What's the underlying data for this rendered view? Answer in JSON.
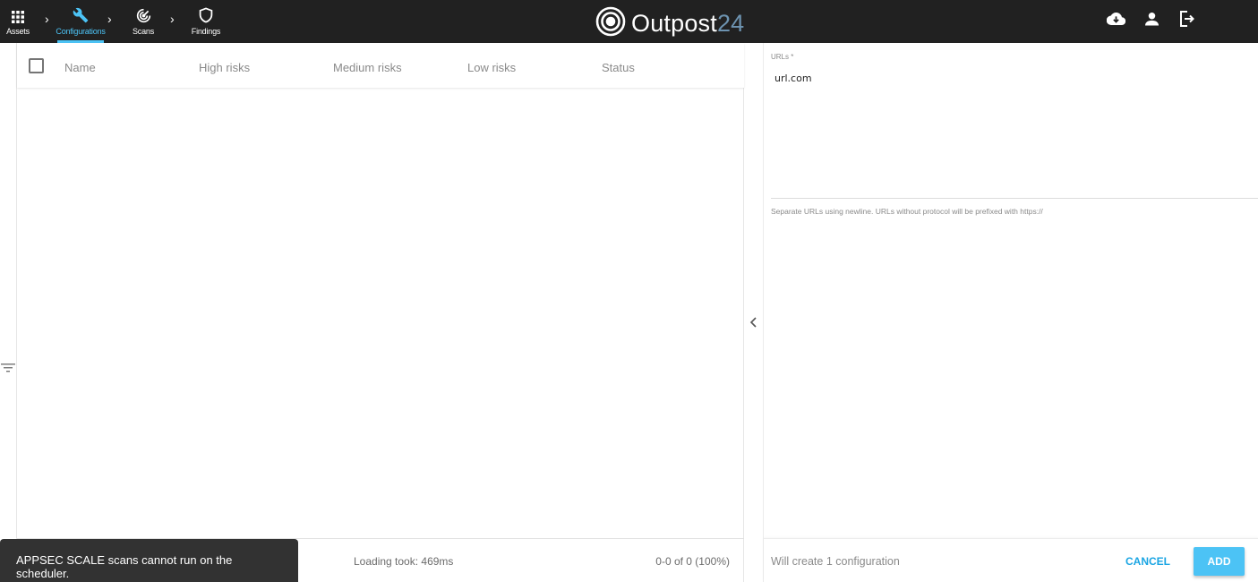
{
  "app": {
    "brand": "Outpost",
    "brand_number": "24"
  },
  "nav": {
    "items": [
      {
        "label": "Assets",
        "icon": "grid-icon",
        "active": false
      },
      {
        "label": "Configurations",
        "icon": "wrench-icon",
        "active": true
      },
      {
        "label": "Scans",
        "icon": "radar-icon",
        "active": false
      },
      {
        "label": "Findings",
        "icon": "shield-icon",
        "active": false
      }
    ],
    "separator": "›"
  },
  "top_actions": [
    {
      "name": "download",
      "icon": "cloud-download-icon"
    },
    {
      "name": "account",
      "icon": "user-icon"
    },
    {
      "name": "logout",
      "icon": "logout-icon"
    }
  ],
  "table": {
    "columns": [
      "Name",
      "High risks",
      "Medium risks",
      "Low risks",
      "Status"
    ],
    "rows": [],
    "footer": {
      "loading": "Loading took: 469ms",
      "pager": "0-0 of 0 (100%)"
    }
  },
  "panel": {
    "urls_label": "URLs *",
    "urls_value": "url.com",
    "hint": "Separate URLs using newline. URLs without protocol will be prefixed with https://",
    "summary": "Will create 1 configuration",
    "cancel_label": "CANCEL",
    "add_label": "ADD"
  },
  "toast": {
    "message": "APPSEC SCALE scans cannot run on the scheduler."
  },
  "colors": {
    "accent": "#4cc3f5",
    "topbar": "#212121",
    "toast": "#323232",
    "cancel": "#1aa5e3"
  }
}
